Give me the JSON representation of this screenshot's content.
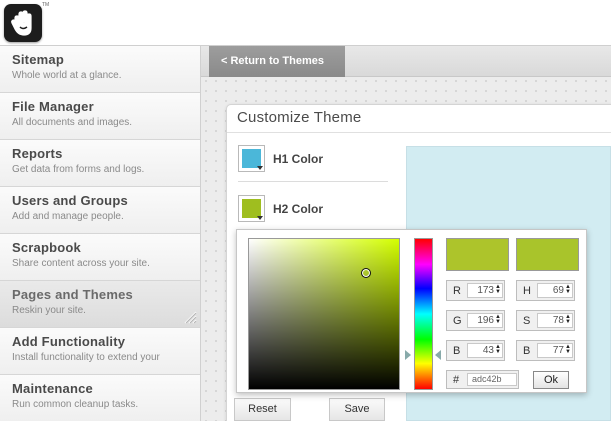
{
  "logo": {
    "tm": "TM"
  },
  "return_button": "< Return to Themes",
  "sidebar": {
    "items": [
      {
        "title": "Sitemap",
        "desc": "Whole world at a glance."
      },
      {
        "title": "File Manager",
        "desc": "All documents and images."
      },
      {
        "title": "Reports",
        "desc": "Get data from forms and logs."
      },
      {
        "title": "Users and Groups",
        "desc": "Add and manage people."
      },
      {
        "title": "Scrapbook",
        "desc": "Share content across your site."
      },
      {
        "title": "Pages and Themes",
        "desc": "Reskin your site."
      },
      {
        "title": "Add Functionality",
        "desc": "Install functionality to extend your"
      },
      {
        "title": "Maintenance",
        "desc": "Run common cleanup tasks."
      }
    ]
  },
  "panel": {
    "title": "Customize Theme",
    "colors": [
      {
        "label": "H1 Color",
        "hex": "#4bb7d9"
      },
      {
        "label": "H2 Color",
        "hex": "#9fbe1f"
      }
    ],
    "reset_label": "Reset",
    "save_label": "Save"
  },
  "picker": {
    "selected_color": "#adc42b",
    "previous_color": "#a9c42b",
    "rgb": {
      "r_label": "R",
      "r": "173",
      "g_label": "G",
      "g": "196",
      "b_label": "B",
      "b": "43"
    },
    "hsb": {
      "h_label": "H",
      "h": "69",
      "s_label": "S",
      "s": "78",
      "b_label": "B",
      "b": "77"
    },
    "hex_label": "#",
    "hex": "adc42b",
    "ok_label": "Ok"
  }
}
